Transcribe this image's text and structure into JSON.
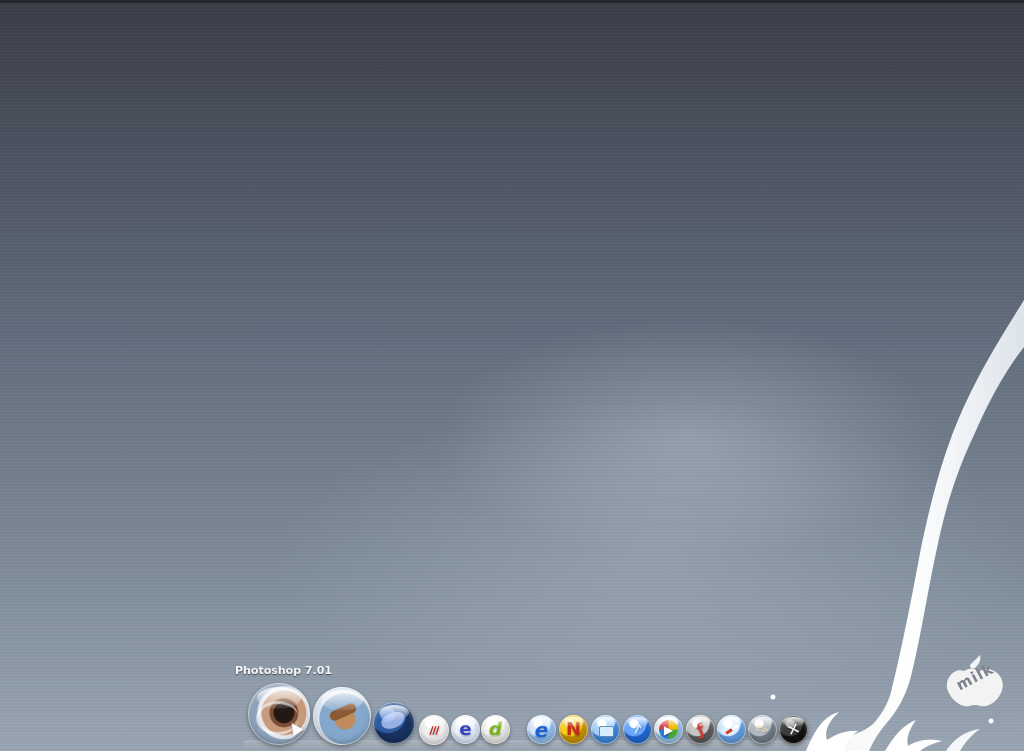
{
  "desktop": {
    "tooltip": "Photoshop 7.01",
    "logo_text": "milk",
    "background_colors": {
      "top": "#3a3d47",
      "middle": "#667181",
      "bottom": "#9aa6b3"
    }
  },
  "dock": {
    "items": [
      {
        "name": "photoshop",
        "icon": "photoshop-icon"
      },
      {
        "name": "painter",
        "icon": "painter-icon"
      },
      {
        "name": "globe",
        "icon": "globe-icon"
      },
      {
        "name": "dreamweaver",
        "icon": "dreamweaver-icon"
      },
      {
        "name": "swirl",
        "icon": "e-swirl-icon"
      },
      {
        "name": "green-d",
        "icon": "green-d-icon"
      },
      {
        "name": "internet-explorer",
        "icon": "internet-explorer-icon"
      },
      {
        "name": "norton",
        "icon": "norton-icon"
      },
      {
        "name": "folder",
        "icon": "folder-icon"
      },
      {
        "name": "graph",
        "icon": "graph-icon"
      },
      {
        "name": "media-player",
        "icon": "media-player-icon"
      },
      {
        "name": "flash",
        "icon": "flash-icon"
      },
      {
        "name": "safari",
        "icon": "safari-icon"
      },
      {
        "name": "tools",
        "icon": "tools-icon"
      },
      {
        "name": "utility",
        "icon": "utility-icon"
      }
    ]
  }
}
